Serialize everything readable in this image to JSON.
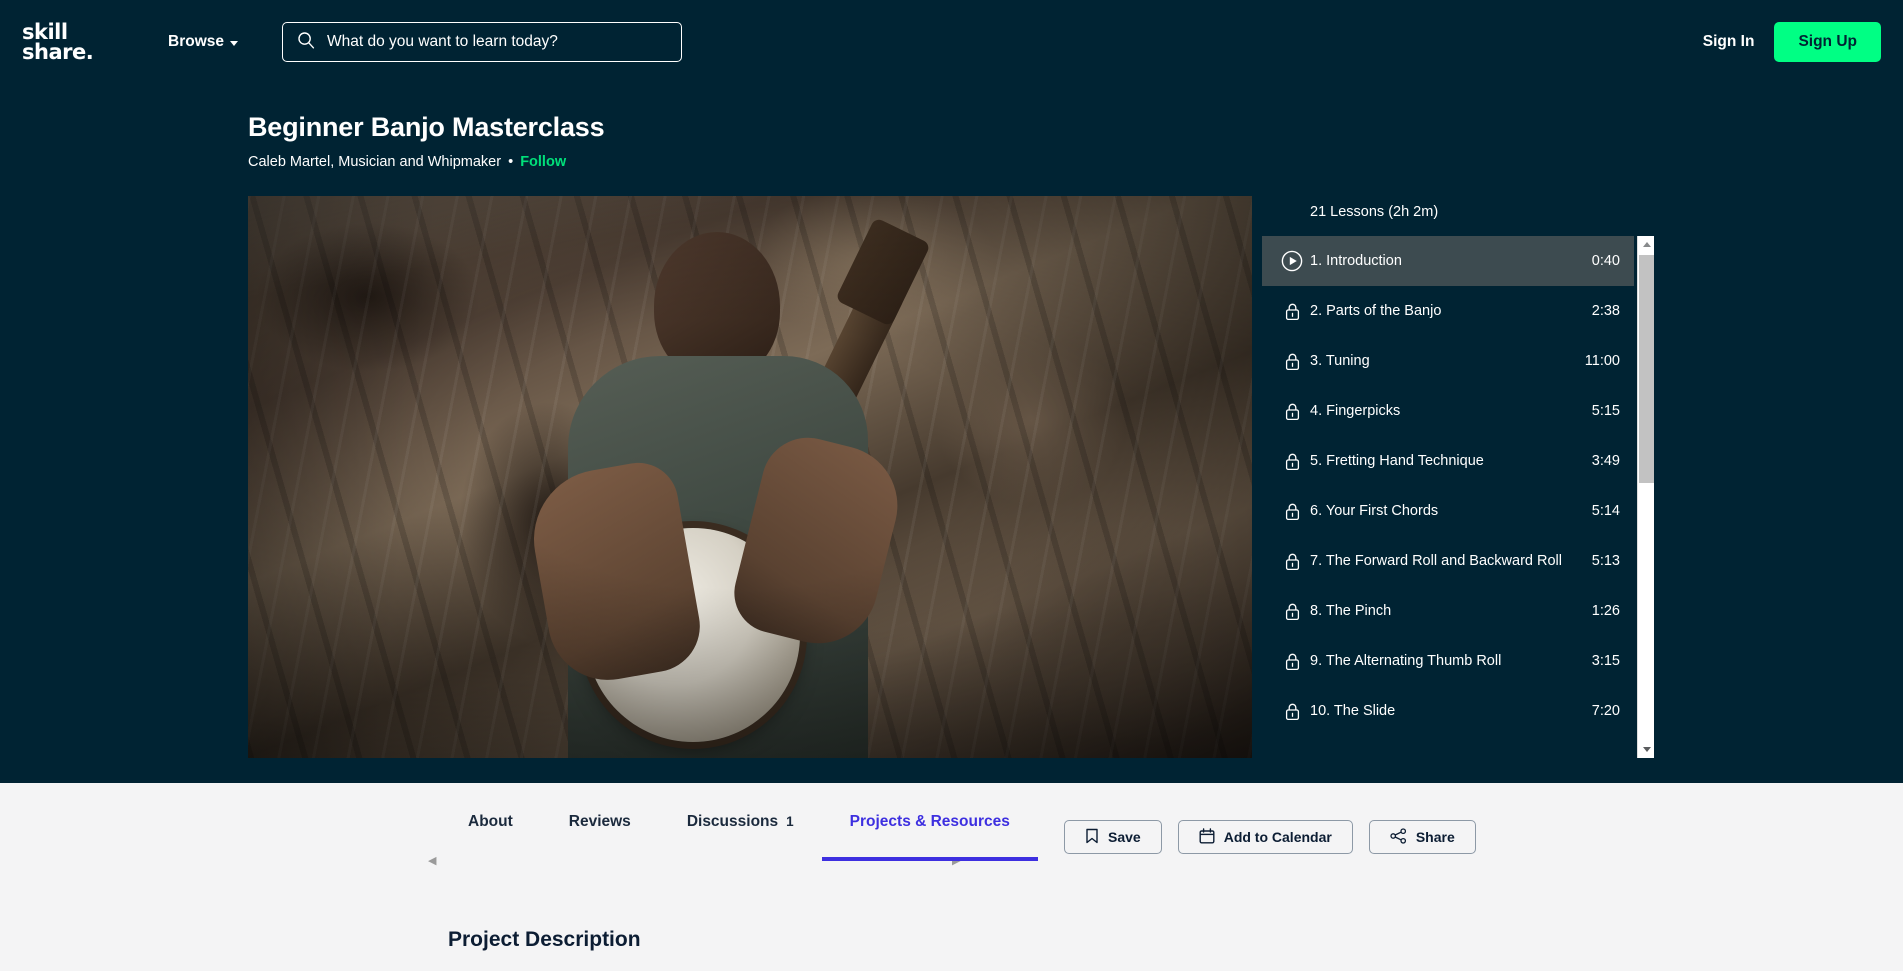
{
  "brand": {
    "logo_line1": "skill",
    "logo_line2": "share.",
    "accent_green": "#00ff84",
    "accent_purple": "#3d2fe0",
    "dark_navy": "#002333"
  },
  "header": {
    "browse_label": "Browse",
    "search_placeholder": "What do you want to learn today?",
    "search_value": "",
    "sign_in_label": "Sign In",
    "sign_up_label": "Sign Up"
  },
  "course": {
    "title": "Beginner Banjo Masterclass",
    "author": "Caleb Martel, Musician and Whipmaker",
    "separator": "•",
    "follow_label": "Follow"
  },
  "lessons": {
    "summary": "21 Lessons (2h 2m)",
    "items": [
      {
        "title": "1. Introduction",
        "duration": "0:40",
        "state": "playing"
      },
      {
        "title": "2. Parts of the Banjo",
        "duration": "2:38",
        "state": "locked"
      },
      {
        "title": "3. Tuning",
        "duration": "11:00",
        "state": "locked"
      },
      {
        "title": "4. Fingerpicks",
        "duration": "5:15",
        "state": "locked"
      },
      {
        "title": "5. Fretting Hand Technique",
        "duration": "3:49",
        "state": "locked"
      },
      {
        "title": "6. Your First Chords",
        "duration": "5:14",
        "state": "locked"
      },
      {
        "title": "7. The Forward Roll and Backward Roll",
        "duration": "5:13",
        "state": "locked"
      },
      {
        "title": "8. The Pinch",
        "duration": "1:26",
        "state": "locked"
      },
      {
        "title": "9. The Alternating Thumb Roll",
        "duration": "3:15",
        "state": "locked"
      },
      {
        "title": "10. The Slide",
        "duration": "7:20",
        "state": "locked"
      }
    ]
  },
  "tabs": [
    {
      "label": "About",
      "count": "",
      "active": false
    },
    {
      "label": "Reviews",
      "count": "",
      "active": false
    },
    {
      "label": "Discussions",
      "count": "1",
      "active": false
    },
    {
      "label": "Projects & Resources",
      "count": "",
      "active": true
    }
  ],
  "actions": {
    "save_label": "Save",
    "calendar_label": "Add to Calendar",
    "share_label": "Share"
  },
  "content": {
    "project_description_heading": "Project Description"
  }
}
